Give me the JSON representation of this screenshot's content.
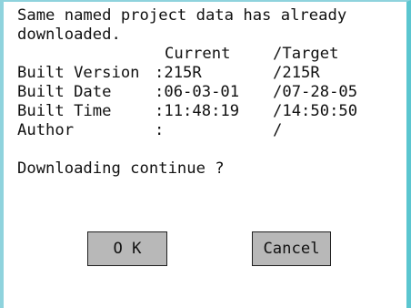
{
  "dialog": {
    "message_line1": "Same named project data has already",
    "message_line2": "downloaded.",
    "header_current": "Current",
    "header_target": "/Target",
    "rows": [
      {
        "label": "Built Version",
        "current": ":215R",
        "target": "/215R"
      },
      {
        "label": "Built Date",
        "current": ":06-03-01",
        "target": "/07-28-05"
      },
      {
        "label": "Built Time",
        "current": ":11:48:19",
        "target": "/14:50:50"
      },
      {
        "label": "Author",
        "current": ":",
        "target": "/"
      }
    ],
    "question": "Downloading continue ?",
    "ok_label": "O K",
    "cancel_label": "Cancel"
  },
  "colors": {
    "frame_accent": "#5bc6d0",
    "button_face": "#b8b8b8"
  }
}
